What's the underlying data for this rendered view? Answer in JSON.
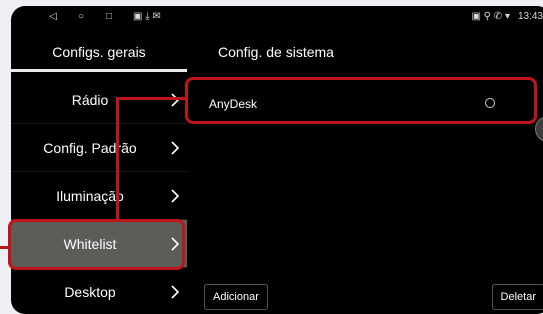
{
  "statusbar": {
    "nav": [
      "◁",
      "○",
      "□"
    ],
    "icons_left": "▣ ⤓ ✉",
    "icons_right": "▣ ⚲ ✆ ▾",
    "time": "13:43"
  },
  "header": {
    "left_title": "Configs. gerais",
    "right_title": "Config. de sistema"
  },
  "sidebar": {
    "items": [
      {
        "label": "Rádio"
      },
      {
        "label": "Config. Padrão"
      },
      {
        "label": "Iluminação"
      },
      {
        "label": "Whitelist",
        "active": true
      },
      {
        "label": "Desktop"
      }
    ]
  },
  "list": {
    "items": [
      {
        "label": "AnyDesk",
        "selected": false
      }
    ]
  },
  "buttons": {
    "add": "Adicionar",
    "delete": "Deletar"
  },
  "colors": {
    "highlight": "#c0141b",
    "active_item": "#5b5d58",
    "background": "#000000"
  }
}
